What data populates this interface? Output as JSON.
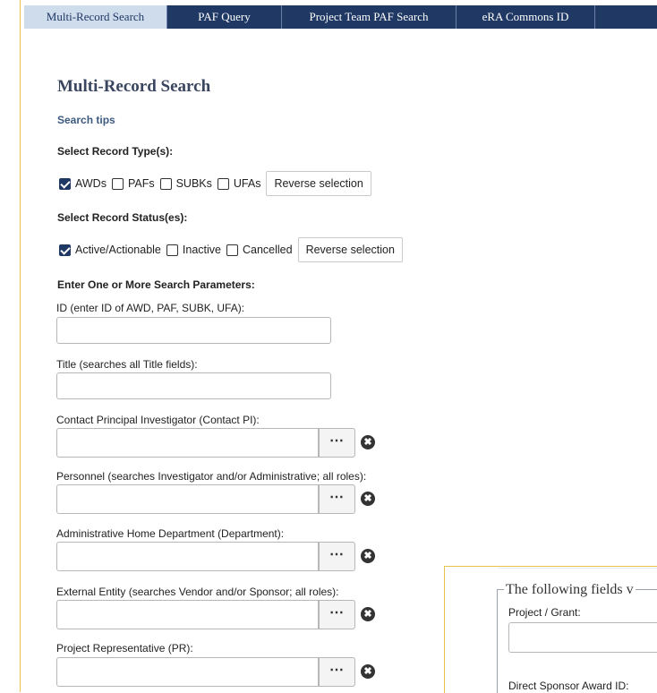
{
  "tabs": [
    {
      "label": "Multi-Record Search",
      "active": true
    },
    {
      "label": "PAF Query"
    },
    {
      "label": "Project Team PAF Search"
    },
    {
      "label": "eRA Commons ID"
    },
    {
      "label": ""
    }
  ],
  "page_title": "Multi-Record Search",
  "search_tips": "Search tips",
  "record_types": {
    "heading": "Select Record Type(s):",
    "options": [
      {
        "label": "AWDs",
        "checked": true
      },
      {
        "label": "PAFs",
        "checked": false
      },
      {
        "label": "SUBKs",
        "checked": false
      },
      {
        "label": "UFAs",
        "checked": false
      }
    ],
    "reverse_label": "Reverse selection"
  },
  "record_status": {
    "heading": "Select Record Status(es):",
    "options": [
      {
        "label": "Active/Actionable",
        "checked": true
      },
      {
        "label": "Inactive",
        "checked": false
      },
      {
        "label": "Cancelled",
        "checked": false
      }
    ],
    "reverse_label": "Reverse selection"
  },
  "params_heading": "Enter One or More Search Parameters:",
  "fields": {
    "id": {
      "label": "ID (enter ID of AWD, PAF, SUBK, UFA):",
      "value": ""
    },
    "title": {
      "label": "Title (searches all Title fields):",
      "value": ""
    },
    "contact_pi": {
      "label": "Contact Principal Investigator (Contact PI):",
      "value": ""
    },
    "personnel": {
      "label": "Personnel (searches Investigator and/or Administrative; all roles):",
      "value": ""
    },
    "department": {
      "label": "Administrative Home Department (Department):",
      "value": ""
    },
    "external_entity": {
      "label": "External Entity (searches Vendor and/or Sponsor; all roles):",
      "value": ""
    },
    "project_rep": {
      "label": "Project Representative (PR):",
      "value": ""
    }
  },
  "lookup_glyph": "⋯",
  "clear_glyph": "✖",
  "side_panel": {
    "legend": "The following fields v",
    "project_grant_label": "Project / Grant:",
    "direct_sponsor_label": "Direct Sponsor Award ID:"
  }
}
